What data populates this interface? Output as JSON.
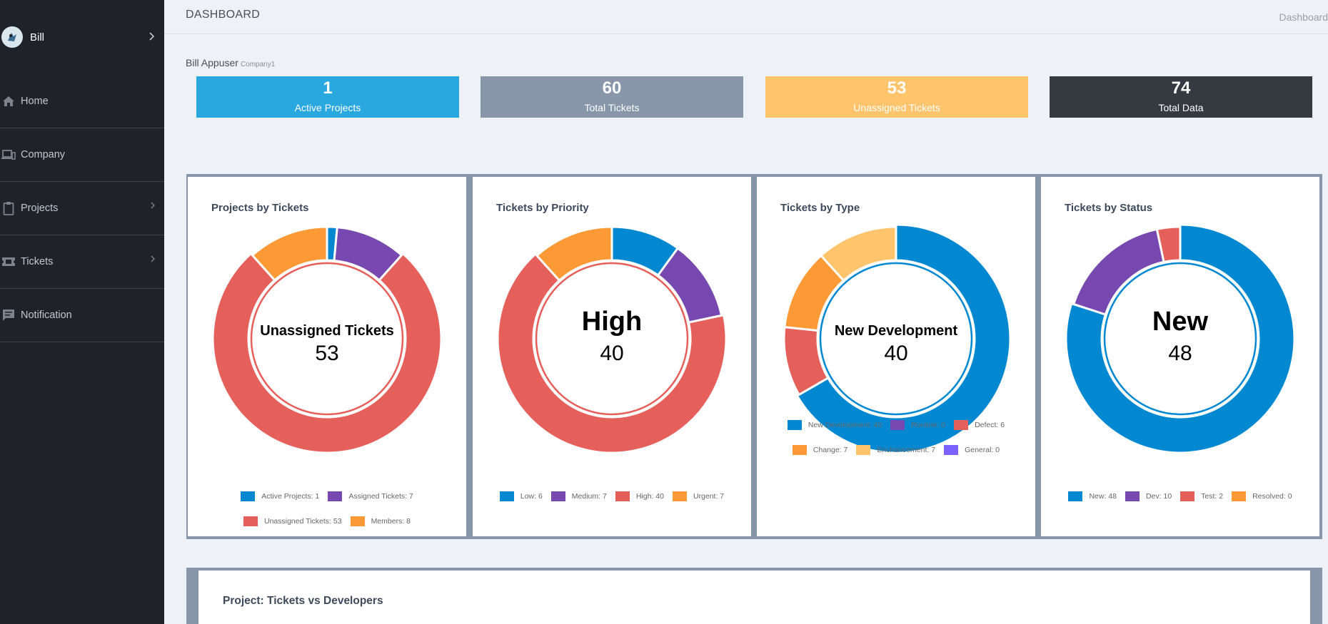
{
  "sidebar": {
    "user": {
      "name": "Bill"
    },
    "items": [
      {
        "label": "Home",
        "icon": "home-icon",
        "chevron": false
      },
      {
        "label": "Company",
        "icon": "laptop-icon",
        "chevron": false
      },
      {
        "label": "Projects",
        "icon": "clipboard-icon",
        "chevron": true
      },
      {
        "label": "Tickets",
        "icon": "ticket-icon",
        "chevron": true
      },
      {
        "label": "Notification",
        "icon": "message-icon",
        "chevron": false
      }
    ]
  },
  "header": {
    "title": "DASHBOARD",
    "breadcrumb": "Dashboard"
  },
  "owner": {
    "name": "Bill Appuser",
    "company": "Company1"
  },
  "stats": [
    {
      "value": "1",
      "label": "Active Projects",
      "color": "#29a8e0"
    },
    {
      "value": "60",
      "label": "Total Tickets",
      "color": "#8896aa"
    },
    {
      "value": "53",
      "label": "Unassigned Tickets",
      "color": "#ffc46c"
    },
    {
      "value": "74",
      "label": "Total Data",
      "color": "#343a40"
    }
  ],
  "chart_data": [
    {
      "type": "pie",
      "title": "Projects by Tickets",
      "center_label": "Unassigned Tickets",
      "center_value": "53",
      "center_size": "small",
      "slices": [
        {
          "label": "Active Projects: 1",
          "name": "Active Projects",
          "value": 1,
          "color": "#0288d1"
        },
        {
          "label": "Assigned Tickets: 7",
          "name": "Assigned Tickets",
          "value": 7,
          "color": "#7749b0"
        },
        {
          "label": "Unassigned Tickets: 53",
          "name": "Unassigned Tickets",
          "value": 53,
          "color": "#e5605a"
        },
        {
          "label": "Members: 8",
          "name": "Members",
          "value": 8,
          "color": "#fd9a36"
        }
      ],
      "highlight_index": 2
    },
    {
      "type": "pie",
      "title": "Tickets by Priority",
      "center_label": "High",
      "center_value": "40",
      "center_size": "large",
      "slices": [
        {
          "label": "Low: 6",
          "name": "Low",
          "value": 6,
          "color": "#0288d1"
        },
        {
          "label": "Medium: 7",
          "name": "Medium",
          "value": 7,
          "color": "#7749b0"
        },
        {
          "label": "High: 40",
          "name": "High",
          "value": 40,
          "color": "#e5605a"
        },
        {
          "label": "Urgent: 7",
          "name": "Urgent",
          "value": 7,
          "color": "#fd9a36"
        }
      ],
      "highlight_index": 2
    },
    {
      "type": "pie",
      "title": "Tickets by Type",
      "center_label": "New Development",
      "center_value": "40",
      "center_size": "small",
      "slices": [
        {
          "label": "New Development: 40",
          "name": "New Development",
          "value": 40,
          "color": "#0288d1"
        },
        {
          "label": "Routine: 0",
          "name": "Routine",
          "value": 0,
          "color": "#7749b0"
        },
        {
          "label": "Defect: 6",
          "name": "Defect",
          "value": 6,
          "color": "#e5605a"
        },
        {
          "label": "Change: 7",
          "name": "Change",
          "value": 7,
          "color": "#fd9a36"
        },
        {
          "label": "Enchancement: 7",
          "name": "Enchancement",
          "value": 7,
          "color": "#ffc46c"
        },
        {
          "label": "General: 0",
          "name": "General",
          "value": 0,
          "color": "#7b61ff"
        }
      ],
      "highlight_index": 0
    },
    {
      "type": "pie",
      "title": "Tickets by Status",
      "center_label": "New",
      "center_value": "48",
      "center_size": "large",
      "slices": [
        {
          "label": "New: 48",
          "name": "New",
          "value": 48,
          "color": "#0288d1"
        },
        {
          "label": "Dev: 10",
          "name": "Dev",
          "value": 10,
          "color": "#7749b0"
        },
        {
          "label": "Test: 2",
          "name": "Test",
          "value": 2,
          "color": "#e5605a"
        },
        {
          "label": "Resolved: 0",
          "name": "Resolved",
          "value": 0,
          "color": "#fd9a36"
        }
      ],
      "highlight_index": 0
    }
  ],
  "bottom": {
    "title": "Project: Tickets vs Developers"
  }
}
